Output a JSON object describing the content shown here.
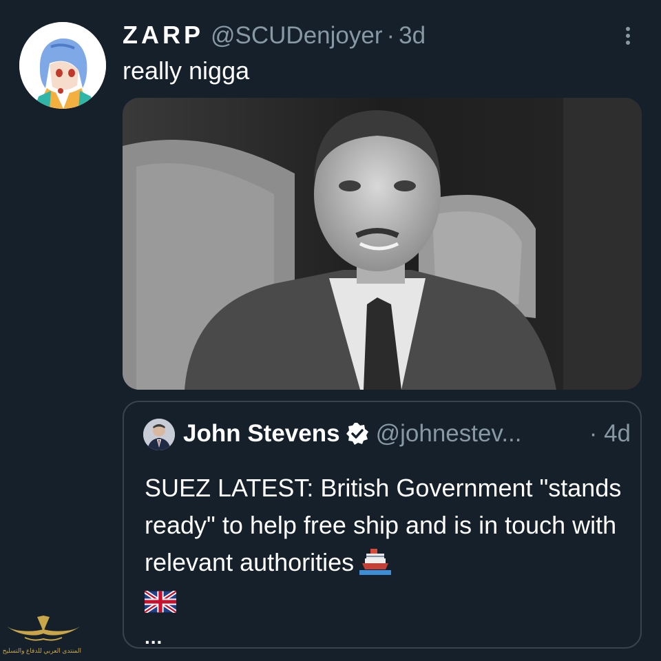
{
  "tweet": {
    "display_name": "ZARP",
    "handle": "@SCUDenjoyer",
    "separator": "·",
    "time": "3d",
    "text": "really nigga",
    "more_icon": "more-vertical-icon",
    "avatar_icon": "anime-avatar"
  },
  "quoted": {
    "name": "John Stevens",
    "verified_icon": "verified-badge-icon",
    "handle": "@johnestev...",
    "time": "· 4d",
    "text": "SUEZ LATEST: British Government \"stands ready\" to help free ship and is in touch with relevant authorities",
    "emoji": [
      "ship-icon",
      "uk-flag-icon"
    ],
    "ellipsis": "..."
  },
  "watermark": {
    "text": "المنتدى العربي للدفاع والتسليح"
  },
  "colors": {
    "background": "#15202b",
    "secondary_text": "#8899a6",
    "border": "#38444d",
    "verified": "#ffffff"
  }
}
